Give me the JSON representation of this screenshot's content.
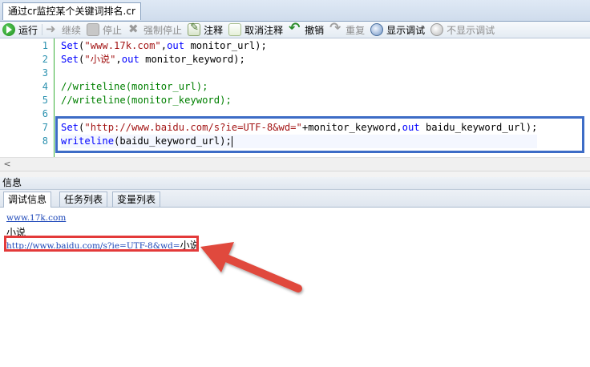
{
  "document_tab": {
    "title": "通过cr监控某个关键词排名.cr"
  },
  "toolbar": {
    "run": "运行",
    "continue": "继续",
    "stop": "停止",
    "force_stop": "强制停止",
    "comment": "注释",
    "uncomment": "取消注释",
    "undo": "撤销",
    "redo": "重复",
    "show_debug": "显示调试",
    "hide_debug": "不显示调试"
  },
  "editor": {
    "line_numbers": [
      "1",
      "2",
      "3",
      "4",
      "5",
      "6",
      "7",
      "8"
    ],
    "lines": [
      {
        "a": "Set",
        "b": "(",
        "c": "\"www.17k.com\"",
        "d": ",",
        "e": "out",
        "f": " monitor_url);"
      },
      {
        "a": "Set",
        "b": "(",
        "c": "\"小说\"",
        "d": ",",
        "e": "out",
        "f": " monitor_keyword);"
      },
      {
        "text": ""
      },
      {
        "comment": "//writeline(monitor_url);"
      },
      {
        "comment": "//writeline(monitor_keyword);"
      },
      {
        "text": ""
      },
      {
        "a": "Set",
        "b": "(",
        "c": "\"http://www.baidu.com/s?ie=UTF-8&wd=\"",
        "d": "+monitor_keyword,",
        "e": "out",
        "f": " baidu_keyword_url);"
      },
      {
        "a": "writeline",
        "f": "(baidu_keyword_url);"
      }
    ]
  },
  "scrollbar": {
    "left_arrow": "<"
  },
  "info_panel": {
    "header": "信息",
    "tabs": [
      "调试信息",
      "任务列表",
      "变量列表"
    ],
    "output": {
      "line1": "www.17k.com",
      "line2": "小说",
      "line3_url": "http://www.baidu.com/s?ie=UTF-8&wd=",
      "line3_keyword": "小说"
    }
  },
  "colors": {
    "annotation_blue": "#3d6cc6",
    "annotation_red": "#e33a3a",
    "arrow_red": "#e0483e"
  }
}
